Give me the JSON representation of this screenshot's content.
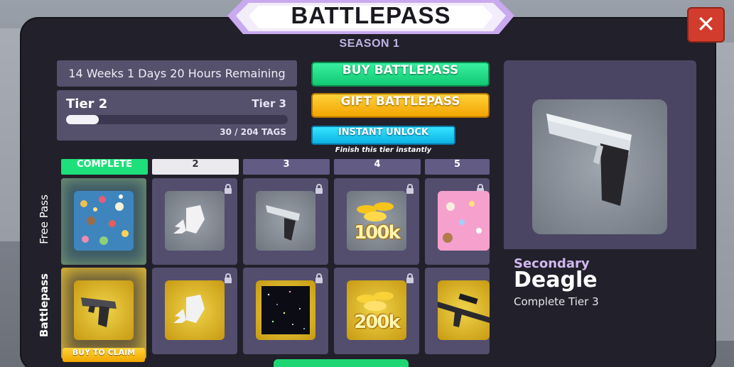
{
  "header": {
    "title": "BATTLEPASS",
    "season": "SEASON 1",
    "close_label": "✕"
  },
  "status": {
    "time_remaining": "14 Weeks 1 Days 20 Hours Remaining",
    "tier_current": "Tier 2",
    "tier_next": "Tier 3",
    "tags_progress": "30 / 204 TAGS",
    "progress_fraction": 0.147
  },
  "actions": {
    "buy_label": "BUY BATTLEPASS",
    "gift_label": "GIFT BATTLEPASS",
    "instant_label": "INSTANT UNLOCK",
    "instant_caption": "Finish this tier instantly"
  },
  "columns": [
    {
      "label": "COMPLETE",
      "state": "complete"
    },
    {
      "label": "2",
      "state": "current"
    },
    {
      "label": "3",
      "state": "locked"
    },
    {
      "label": "4",
      "state": "locked"
    },
    {
      "label": "5",
      "state": "locked"
    }
  ],
  "rows": {
    "free_label": "Free Pass",
    "battlepass_label": "Battlepass"
  },
  "free_rewards": [
    {
      "icon": "sticker-pattern-icon",
      "locked": false
    },
    {
      "icon": "winged-fist-icon",
      "locked": true
    },
    {
      "icon": "deagle-gun-icon",
      "locked": true
    },
    {
      "icon": "coin-stack-icon",
      "coin_text": "100k",
      "locked": true
    },
    {
      "icon": "pink-pattern-icon",
      "locked": true
    }
  ],
  "bp_rewards": [
    {
      "icon": "pistol-gun-icon",
      "claim_label": "BUY TO CLAIM",
      "locked": false
    },
    {
      "icon": "winged-fist-icon",
      "locked": true
    },
    {
      "icon": "galaxy-pattern-icon",
      "locked": true
    },
    {
      "icon": "coin-stack-icon",
      "coin_text": "200k",
      "locked": true
    },
    {
      "icon": "sniper-rifle-icon",
      "locked": true
    }
  ],
  "preview": {
    "category": "Secondary",
    "name": "Deagle",
    "requirement": "Complete Tier 3"
  },
  "colors": {
    "panel": "#22202a",
    "cell": "#534d6e",
    "complete": "#1ee07a",
    "buy": "#12c873",
    "gift": "#f2a400",
    "instant": "#0cb2e4",
    "close": "#d23c2c"
  }
}
